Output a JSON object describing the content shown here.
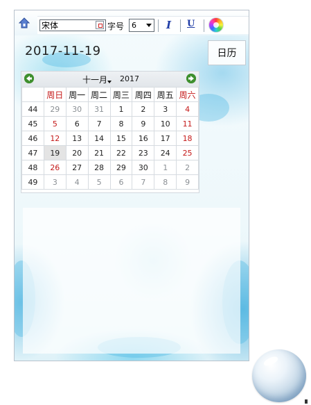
{
  "toolbar": {
    "font_value": "宋体",
    "size_label": "字号",
    "size_value": "6",
    "italic_label": "I",
    "underline_label": "U"
  },
  "date_display": {
    "value": "2017-11-19"
  },
  "calendar_button": {
    "label": "日历"
  },
  "calendar": {
    "month_label": "十一月",
    "year_label": "2017",
    "prev_glyph": "◀",
    "next_glyph": "▶",
    "weekdays": [
      "周日",
      "周一",
      "周二",
      "周三",
      "周四",
      "周五",
      "周六"
    ],
    "weeks": [
      {
        "week": "44",
        "days": [
          "29",
          "30",
          "31",
          "1",
          "2",
          "3",
          "4"
        ]
      },
      {
        "week": "45",
        "days": [
          "5",
          "6",
          "7",
          "8",
          "9",
          "10",
          "11"
        ]
      },
      {
        "week": "46",
        "days": [
          "12",
          "13",
          "14",
          "15",
          "16",
          "17",
          "18"
        ]
      },
      {
        "week": "47",
        "days": [
          "19",
          "20",
          "21",
          "22",
          "23",
          "24",
          "25"
        ]
      },
      {
        "week": "48",
        "days": [
          "26",
          "27",
          "28",
          "29",
          "30",
          "1",
          "2"
        ]
      },
      {
        "week": "49",
        "days": [
          "3",
          "4",
          "5",
          "6",
          "7",
          "8",
          "9"
        ]
      }
    ],
    "selected_day": "19",
    "weekend_color": "#c41818"
  },
  "colors": {
    "accent_blue": "#1f3ca6",
    "nav_green": "#3f8f2e"
  }
}
